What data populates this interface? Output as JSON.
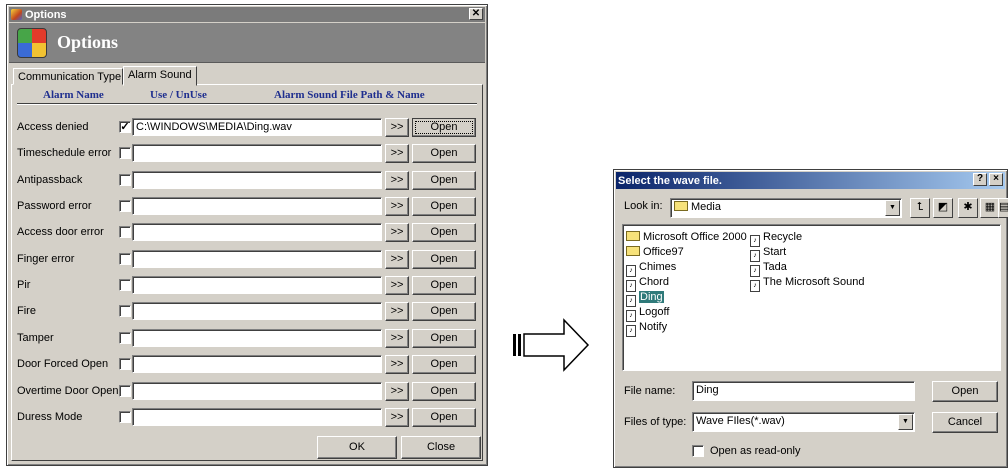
{
  "options": {
    "title": "Options",
    "banner_title": "Options",
    "tabs": [
      "Communication Type",
      "Alarm Sound"
    ],
    "headers": {
      "alarm_name": "Alarm Name",
      "use": "Use / UnUse",
      "path": "Alarm Sound File Path & Name"
    },
    "browse_label": ">>",
    "open_label": "Open",
    "rows": [
      {
        "name": "Access denied",
        "checked": "✓",
        "path": "C:\\WINDOWS\\MEDIA\\Ding.wav"
      },
      {
        "name": "Timeschedule error",
        "checked": "",
        "path": ""
      },
      {
        "name": "Antipassback",
        "checked": "",
        "path": ""
      },
      {
        "name": "Password error",
        "checked": "",
        "path": ""
      },
      {
        "name": "Access door error",
        "checked": "",
        "path": ""
      },
      {
        "name": "Finger error",
        "checked": "",
        "path": ""
      },
      {
        "name": "Pir",
        "checked": "",
        "path": ""
      },
      {
        "name": "Fire",
        "checked": "",
        "path": ""
      },
      {
        "name": "Tamper",
        "checked": "",
        "path": ""
      },
      {
        "name": "Door Forced Open",
        "checked": "",
        "path": ""
      },
      {
        "name": "Overtime Door Open",
        "checked": "",
        "path": ""
      },
      {
        "name": "Duress Mode",
        "checked": "",
        "path": ""
      }
    ],
    "ok_label": "OK",
    "close_label": "Close"
  },
  "filedlg": {
    "title": "Select the wave file.",
    "help_btn": "?",
    "close_btn": "×",
    "lookin_label": "Look in:",
    "lookin_value": "Media",
    "files": [
      {
        "name": "Microsoft Office 2000",
        "type": "folder"
      },
      {
        "name": "Office97",
        "type": "folder"
      },
      {
        "name": "Chimes",
        "type": "wav"
      },
      {
        "name": "Chord",
        "type": "wav"
      },
      {
        "name": "Ding",
        "type": "wav",
        "selected": true
      },
      {
        "name": "Logoff",
        "type": "wav"
      },
      {
        "name": "Notify",
        "type": "wav"
      },
      {
        "name": "Recycle",
        "type": "wav"
      },
      {
        "name": "Start",
        "type": "wav"
      },
      {
        "name": "Tada",
        "type": "wav"
      },
      {
        "name": "The Microsoft Sound",
        "type": "wav"
      }
    ],
    "filename_label": "File name:",
    "filename_value": "Ding",
    "filetype_label": "Files of type:",
    "filetype_value": "Wave FIles(*.wav)",
    "readonly_label": "Open as read-only",
    "open_label": "Open",
    "cancel_label": "Cancel"
  }
}
